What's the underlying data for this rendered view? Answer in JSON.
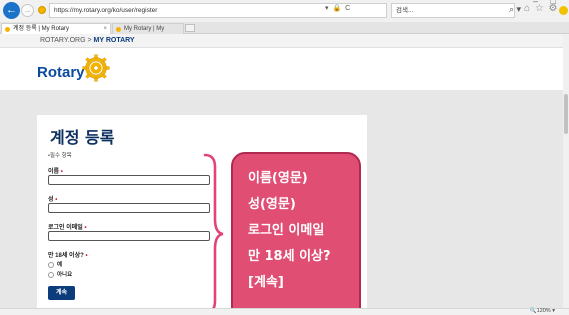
{
  "browser": {
    "back_glyph": "←",
    "forward_glyph": "→",
    "url": "https://my.rotary.org/ko/user/register",
    "url_tools": "▾ 🔒 C",
    "search_placeholder": "검색...",
    "search_glyph": "⌕ ▾",
    "toolbar_icons": "⌂ ☆ ⚙",
    "window_controls": "– □",
    "tabs": [
      {
        "label": "계정 등록 | My Rotary",
        "close": "×",
        "active": true
      },
      {
        "label": "My Rotary | My Rotary",
        "active": false
      }
    ],
    "zoom": "🔍120% ▾"
  },
  "site": {
    "breadcrumb_root": "ROTARY.ORG",
    "breadcrumb_separator": " > ",
    "breadcrumb_current": "MY ROTARY",
    "brand": "Rotary"
  },
  "form": {
    "title": "계정 등록",
    "required_note": "•필수 항목",
    "required_star": "•",
    "fields": [
      {
        "label": "이름"
      },
      {
        "label": "성"
      },
      {
        "label": "로그인 이메일"
      }
    ],
    "age_question": "만 18세 이상?",
    "options": [
      "예",
      "아니요"
    ],
    "continue_label": "계속"
  },
  "callout": {
    "lines": [
      "이름(영문)",
      "성(영문)",
      "로그인 이메일",
      "만 18세 이상?",
      "[계속]"
    ]
  },
  "colors": {
    "rotary_blue": "#0c3c7c",
    "callout_pink": "#e04e74",
    "brace_pink": "#e0457a",
    "rotary_gold": "#f5b400"
  }
}
